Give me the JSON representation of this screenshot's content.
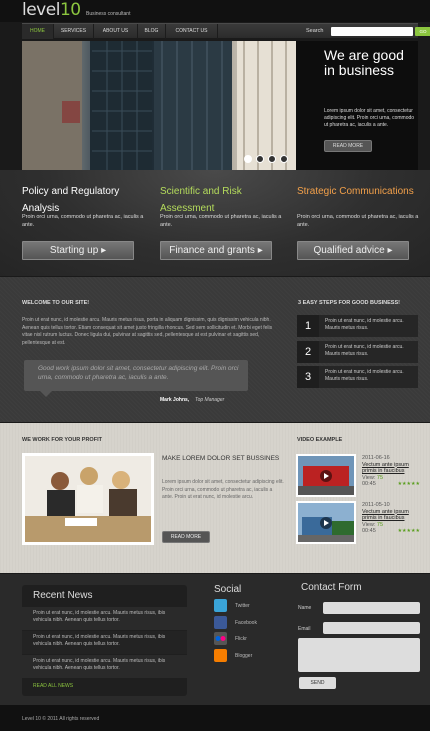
{
  "header": {
    "logo_text": "level",
    "logo_num": "10",
    "tagline": "Business consultant"
  },
  "nav": {
    "items": [
      "HOME",
      "SERVICES",
      "ABOUT US",
      "BLOG",
      "CONTACT US"
    ],
    "search_label": "Search",
    "search_placeholder": "",
    "search_button": "GO"
  },
  "hero": {
    "title": "We are good in business",
    "text": "Lorem ipsum dolor sit amet, consectetur adipiscing elit. Proin orci urna, commodo ut pharetra ac, iaculis a ante.",
    "button": "READ MORE",
    "dots": 4,
    "active_dot": 0
  },
  "features": [
    {
      "title": "Policy and Regulatory Analysis",
      "text": "Proin orci urna, commodo ut pharetra ac, iaculis a ante.",
      "button": "Starting up",
      "color": "#ffffff"
    },
    {
      "title": "Scientific and Risk Assessment",
      "text": "Proin orci urna, commodo ut pharetra ac, iaculis a ante.",
      "button": "Finance and grants",
      "color": "#b5dc5c"
    },
    {
      "title": "Strategic Communications",
      "text": "Proin orci urna, commodo ut pharetra ac, iaculis a ante.",
      "button": "Qualified advice",
      "color": "#f2a04a"
    }
  ],
  "welcome": {
    "heading": "WELCOME TO OUR SITE!",
    "text": "Proin ut erat nunc, id molestie arcu. Mauris metus risus, porta in aliquam dignissim, quis dignissim vehicula nibh. Aenean quis tellus tortor. Etiam consequat sit amet justo fringilla rhoncus. Sed sem sollicitudin et. Morbi eget felis vitae nisl rutrum luctus. Donec ligula dui, pulvinar at sagittis sed, pellentesque at est pulvinar et sagittis sed, pellentesque at est.",
    "quote": "Good work ipsum dolor sit amet, consectetur adipiscing elit. Proin orci urna, commodo ut pharetra ac, iaculis a ante.",
    "quote_author": "Mark Johns,",
    "quote_role": "Top Manager"
  },
  "steps": {
    "heading": "3 EASY STEPS FOR GOOD BUSINESS!",
    "items": [
      {
        "num": "1",
        "text": "Proin ut erat nunc, id molestie arcu. Mauris metus risus."
      },
      {
        "num": "2",
        "text": "Proin ut erat nunc, id molestie arcu. Mauris metus risus."
      },
      {
        "num": "3",
        "text": "Proin ut erat nunc, id molestie arcu. Mauris metus risus."
      }
    ]
  },
  "work": {
    "heading": "WE WORK FOR YOUR PROFIT",
    "title": "MAKE LOREM DOLOR SET BUSSINES",
    "text": "Lorem ipsum dolor sit amet, consectetur adipiscing elit. Proin orci urna, commodo ut pharetra ac, iaculis a ante. Proin ut erat nunc, id molestie arcu.",
    "button": "READ MORE"
  },
  "video": {
    "heading": "VIDEO EXAMPLE",
    "items": [
      {
        "date": "2011-06-16",
        "title": "Vectum ante ipsum primis in faucibus",
        "views_label": "View:",
        "views": "75",
        "time": "00:45",
        "stars": "★★★★★"
      },
      {
        "date": "2011-05-10",
        "title": "Vectum ante ipsum primis in faucibus",
        "views_label": "View:",
        "views": "75",
        "time": "00:45",
        "stars": "★★★★★"
      }
    ]
  },
  "news": {
    "heading": "Recent News",
    "items": [
      "Proin ut erat nunc, id molestie arcu. Mauris metus risus, ibis vehicula nibh. Aenean quis tellus tortor.",
      "Proin ut erat nunc, id molestie arcu. Mauris metus risus, ibis vehicula nibh. Aenean quis tellus tortor.",
      "Proin ut erat nunc, id molestie arcu. Mauris metus risus, ibis vehicula nibh. Aenean quis tellus tortor."
    ],
    "all_link": "READ ALL NEWS"
  },
  "social": {
    "heading": "Social",
    "items": [
      {
        "label": "Twitter",
        "icon": "twitter-icon",
        "color": "#3aa4d8"
      },
      {
        "label": "Facebook",
        "icon": "facebook-icon",
        "color": "#3b5998"
      },
      {
        "label": "Flickr",
        "icon": "flickr-icon",
        "color": "#555555"
      },
      {
        "label": "Blogger",
        "icon": "blogger-icon",
        "color": "#f57d00"
      }
    ]
  },
  "contact": {
    "heading": "Contact Form",
    "name_label": "Name",
    "email_label": "Email",
    "send": "SEND"
  },
  "footer": {
    "copyright": "Level 10 © 2011   All rights reserved"
  }
}
